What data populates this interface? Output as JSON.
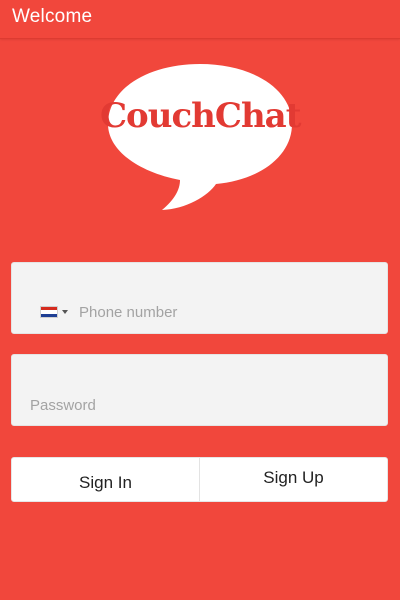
{
  "app_bar": {
    "title": "Welcome"
  },
  "logo": {
    "text": "CouchChat",
    "icon": "speech-bubble-icon",
    "text_color": "#e23a33"
  },
  "phone_field": {
    "placeholder": "Phone number",
    "value": "",
    "country_flag": "croatia-flag-icon"
  },
  "password_field": {
    "placeholder": "Password",
    "value": ""
  },
  "actions": {
    "sign_in_label": "Sign In",
    "sign_up_label": "Sign Up"
  },
  "colors": {
    "background": "#f1473c",
    "field_background": "#f3f3f3",
    "button_background": "#ffffff"
  }
}
